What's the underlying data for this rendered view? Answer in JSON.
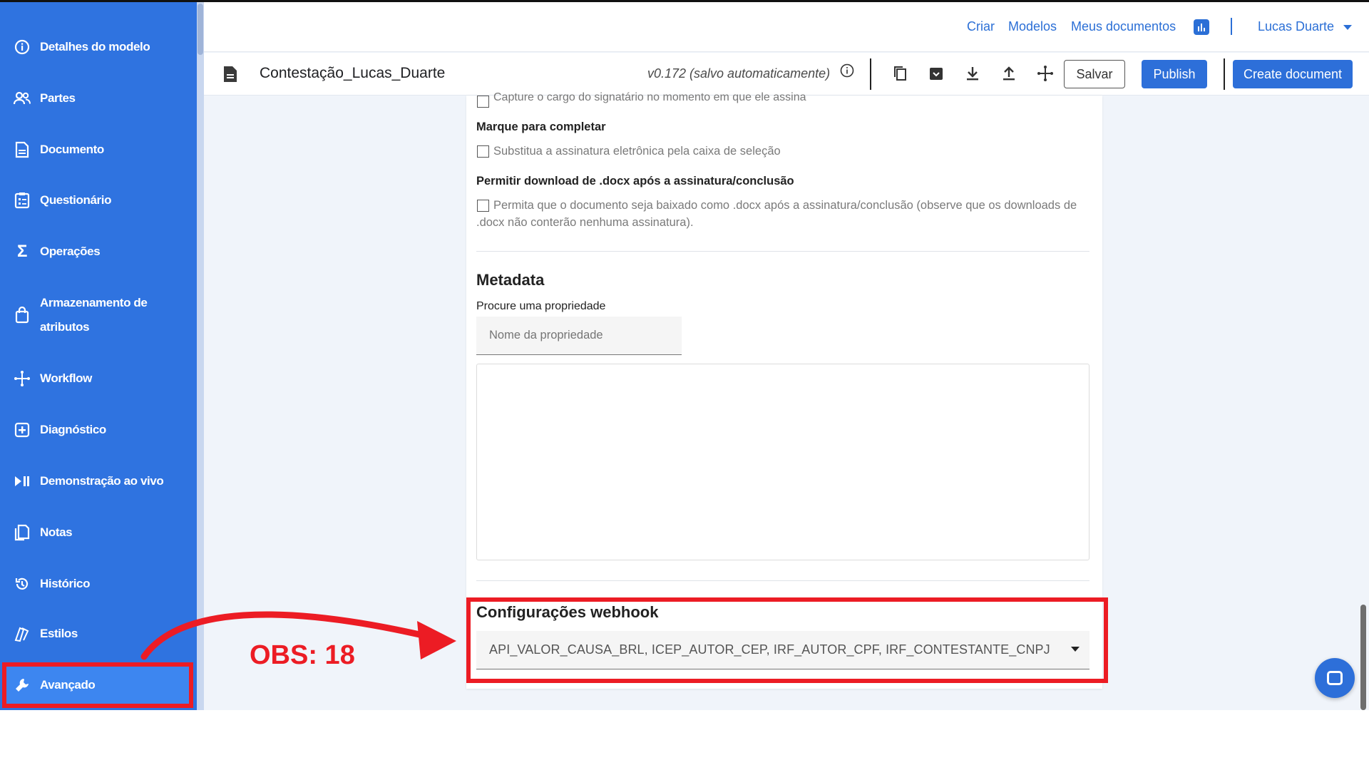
{
  "sidebar": {
    "items": [
      {
        "label": "Detalhes do modelo",
        "icon": "info-icon"
      },
      {
        "label": "Partes",
        "icon": "people-icon"
      },
      {
        "label": "Documento",
        "icon": "document-icon"
      },
      {
        "label": "Questionário",
        "icon": "clipboard-icon"
      },
      {
        "label": "Operações",
        "icon": "sigma-icon"
      },
      {
        "label": "Armazenamento de",
        "label2": "atributos",
        "icon": "bag-icon"
      },
      {
        "label": "Workflow",
        "icon": "workflow-icon"
      },
      {
        "label": "Diagnóstico",
        "icon": "plus-box-icon"
      },
      {
        "label": "Demonstração ao vivo",
        "icon": "play-pause-icon"
      },
      {
        "label": "Notas",
        "icon": "notes-icon"
      },
      {
        "label": "Histórico",
        "icon": "history-icon"
      },
      {
        "label": "Estilos",
        "icon": "styles-icon"
      },
      {
        "label": "Avançado",
        "icon": "wrench-icon"
      }
    ]
  },
  "topnav": {
    "criar": "Criar",
    "modelos": "Modelos",
    "meus_documentos": "Meus documentos",
    "user": "Lucas Duarte"
  },
  "toolbar": {
    "doc_title": "Contestação_Lucas_Duarte",
    "version": "v0.172 (salvo automaticamente)",
    "salvar": "Salvar",
    "publish": "Publish",
    "create": "Create document"
  },
  "content": {
    "cut_text": "Capture o cargo do signatário no momento em que ele assina",
    "section1_label": "Marque para completar",
    "section1_cb": "Substitua a assinatura eletrônica pela caixa de seleção",
    "section2_label": "Permitir download de .docx após a assinatura/conclusão",
    "section2_cb_line1": "Permita que o documento seja baixado como .docx após a assinatura/conclusão (observe que os downloads de",
    "section2_cb_line2": ".docx não conterão nenhuma assinatura).",
    "metadata_title": "Metadata",
    "metadata_label": "Procure uma propriedade",
    "metadata_placeholder": "Nome da propriedade",
    "webhook_title": "Configurações webhook",
    "webhook_value": "API_VALOR_CAUSA_BRL, ICEP_AUTOR_CEP, IRF_AUTOR_CPF, IRF_CONTESTANTE_CNPJ"
  },
  "annotation": {
    "text": "OBS: 18",
    "color": "#ec1c24"
  },
  "colors": {
    "sidebar": "#2f73e0",
    "accent": "#2d6fd9",
    "highlight": "#ec1c24"
  }
}
